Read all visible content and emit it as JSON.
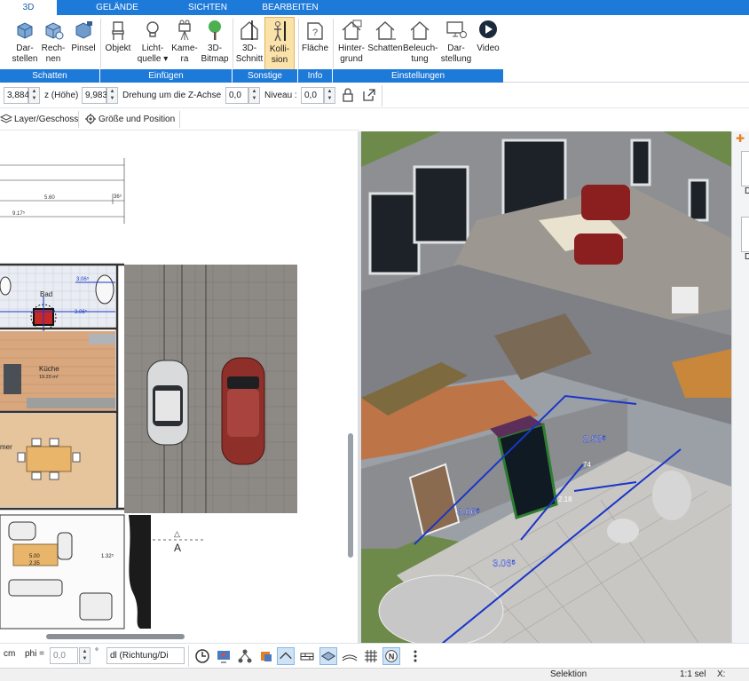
{
  "tabs": [
    {
      "label": "3D",
      "active": true
    },
    {
      "label": "GELÄNDE",
      "active": false
    },
    {
      "label": "SICHTEN",
      "active": false
    },
    {
      "label": "BEARBEITEN",
      "active": false
    }
  ],
  "ribbon": {
    "buttons": [
      {
        "line1": "Dar-",
        "line2": "stellen",
        "icon": "cube-display-icon"
      },
      {
        "line1": "Rech-",
        "line2": "nen",
        "icon": "cube-render-icon"
      },
      {
        "line1": "Pinsel",
        "line2": "",
        "icon": "paint-brush-icon"
      },
      {
        "line1": "Objekt",
        "line2": "",
        "icon": "chair-icon"
      },
      {
        "line1": "Licht-",
        "line2": "quelle",
        "icon": "light-bulb-icon"
      },
      {
        "line1": "Kame-",
        "line2": "ra",
        "icon": "camera-icon"
      },
      {
        "line1": "3D-",
        "line2": "Bitmap",
        "icon": "tree-icon"
      },
      {
        "line1": "3D-",
        "line2": "Schnitt",
        "icon": "section-cut-icon"
      },
      {
        "line1": "Kolli-",
        "line2": "sion",
        "icon": "collision-person-icon"
      },
      {
        "line1": "Fläche",
        "line2": "",
        "icon": "area-info-icon"
      },
      {
        "line1": "Hinter-",
        "line2": "grund",
        "icon": "house-background-icon"
      },
      {
        "line1": "Schatten",
        "line2": "",
        "icon": "house-shadow-icon"
      },
      {
        "line1": "Beleuch-",
        "line2": "tung",
        "icon": "house-lighting-icon"
      },
      {
        "line1": "Dar-",
        "line2": "stellung",
        "icon": "monitor-settings-icon"
      },
      {
        "line1": "Video",
        "line2": "",
        "icon": "play-icon"
      }
    ],
    "groups": [
      "Schatten",
      "Einfügen",
      "Sonstige",
      "Info",
      "Einstellungen"
    ]
  },
  "coordbar": {
    "value1": "3,884",
    "label_z": "z (Höhe)",
    "value_z": "9,983",
    "label_rot": "Drehung um die Z-Achse",
    "value_rot": "0,0",
    "label_level": "Niveau :",
    "value_level": "0,0"
  },
  "layerbar": {
    "layer_label": "Layer/Geschoss",
    "size_label": "Größe und Position"
  },
  "plan": {
    "dims": [
      "5.60",
      "9.17⁵",
      "36⁵"
    ],
    "room_bad": "Bad",
    "room_kueche": "Küche",
    "room_kueche_area": "19.20 m²",
    "room_zimmer": "mer",
    "dim_bad_top": "3.06⁵",
    "dim_bad_mid": "3.06⁵",
    "section_marker": "A",
    "table_dim": "5.00",
    "table_dim2": "2.35",
    "dim_side": "1.32⁵"
  },
  "view3d": {
    "dim_a": "2.53⁵",
    "dim_b": "3.06⁵",
    "dim_c": "3.06⁵",
    "dim_d": "74",
    "dim_e": "2.18"
  },
  "rightpanel": {
    "label1": "D",
    "label2": "D"
  },
  "bottombar": {
    "unit": "cm",
    "phi_label": "phi =",
    "phi_value": "0,0",
    "deg": "°",
    "direction": "dl (Richtung/Di"
  },
  "statusbar": {
    "selection": "Selektion",
    "scale": "1:1 sel",
    "x_label": "X:"
  },
  "colors": {
    "accent": "#1e7ad9",
    "active_button": "#fbe2a9",
    "dimension_line": "#1a36c8"
  }
}
